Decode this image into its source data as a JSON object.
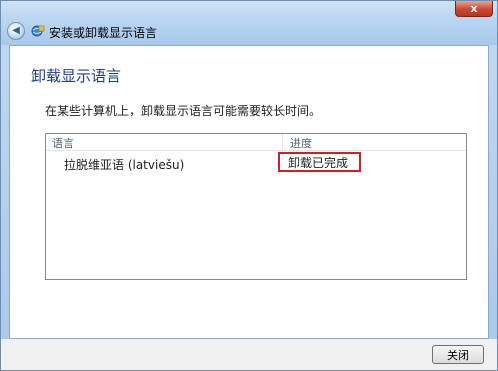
{
  "window": {
    "title": "安装或卸载显示语言",
    "close_glyph": "x"
  },
  "page": {
    "heading": "卸载显示语言",
    "info": "在某些计算机上，卸载显示语言可能需要较长时间。"
  },
  "list": {
    "columns": [
      "语言",
      "进度"
    ],
    "rows": [
      {
        "language": "拉脱维亚语 (latviešu)",
        "status": "卸载已完成"
      }
    ]
  },
  "footer": {
    "close_label": "关闭"
  },
  "colors": {
    "highlight_border": "#d21f26",
    "heading_text": "#1e3d8f"
  },
  "icons": {
    "back": "back-arrow-icon",
    "app": "language-icon"
  }
}
